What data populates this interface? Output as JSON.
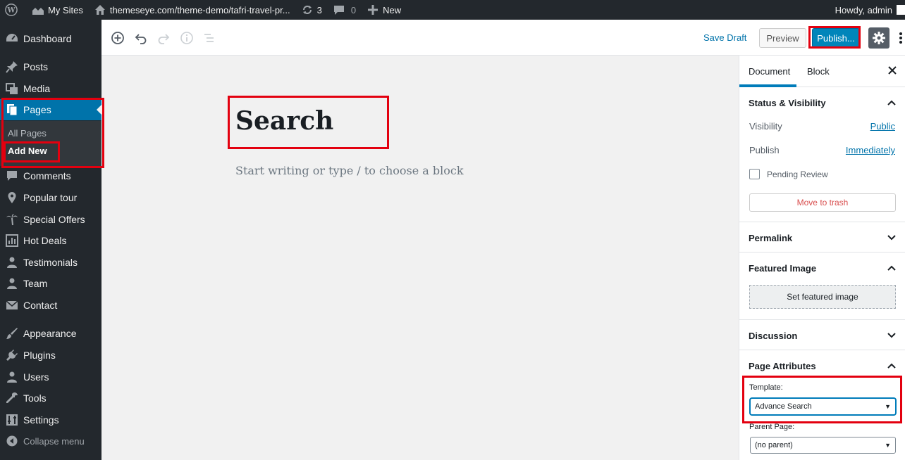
{
  "adminbar": {
    "my_sites": "My Sites",
    "site_url": "themeseye.com/theme-demo/tafri-travel-pr...",
    "updates_count": "3",
    "comments_count": "0",
    "new_label": "New",
    "howdy": "Howdy, admin"
  },
  "sidebar": {
    "dashboard": "Dashboard",
    "posts": "Posts",
    "media": "Media",
    "pages": "Pages",
    "all_pages": "All Pages",
    "add_new": "Add New",
    "comments": "Comments",
    "popular_tour": "Popular tour",
    "special_offers": "Special Offers",
    "hot_deals": "Hot Deals",
    "testimonials": "Testimonials",
    "team": "Team",
    "contact": "Contact",
    "appearance": "Appearance",
    "plugins": "Plugins",
    "users": "Users",
    "tools": "Tools",
    "settings": "Settings",
    "collapse": "Collapse menu"
  },
  "header": {
    "save_draft": "Save Draft",
    "preview": "Preview",
    "publish": "Publish..."
  },
  "editor": {
    "title": "Search",
    "placeholder": "Start writing or type / to choose a block"
  },
  "settings": {
    "tab_document": "Document",
    "tab_block": "Block",
    "status_visibility": "Status & Visibility",
    "visibility_label": "Visibility",
    "visibility_value": "Public",
    "publish_label": "Publish",
    "publish_value": "Immediately",
    "pending_review": "Pending Review",
    "move_to_trash": "Move to trash",
    "permalink": "Permalink",
    "featured_image": "Featured Image",
    "set_featured_image": "Set featured image",
    "discussion": "Discussion",
    "page_attributes": "Page Attributes",
    "template_label": "Template:",
    "template_value": "Advance Search",
    "parent_label": "Parent Page:",
    "parent_value": "(no parent)"
  },
  "icons": [
    "wordpress-icon",
    "my-sites-icon",
    "home-icon",
    "updates-icon",
    "comments-bubble-icon",
    "plus-icon",
    "dashboard-icon",
    "posts-pin-icon",
    "media-icon",
    "pages-icon",
    "comments-icon",
    "location-pin-icon",
    "palm-tree-icon",
    "chart-icon",
    "testimonials-icon",
    "team-icon",
    "mail-icon",
    "appearance-brush-icon",
    "plugins-icon",
    "users-icon",
    "tools-wrench-icon",
    "settings-icon",
    "collapse-icon",
    "add-block-icon",
    "undo-icon",
    "redo-icon",
    "info-icon",
    "outline-icon",
    "gear-icon",
    "more-vertical-icon",
    "close-icon",
    "chevron-up-icon",
    "chevron-down-icon"
  ],
  "colors": {
    "admin_dark": "#23282d",
    "wp_blue": "#0073aa",
    "publish_blue": "#0085ba",
    "annotation_red": "#e3000f",
    "trash_red": "#d94f4f"
  }
}
